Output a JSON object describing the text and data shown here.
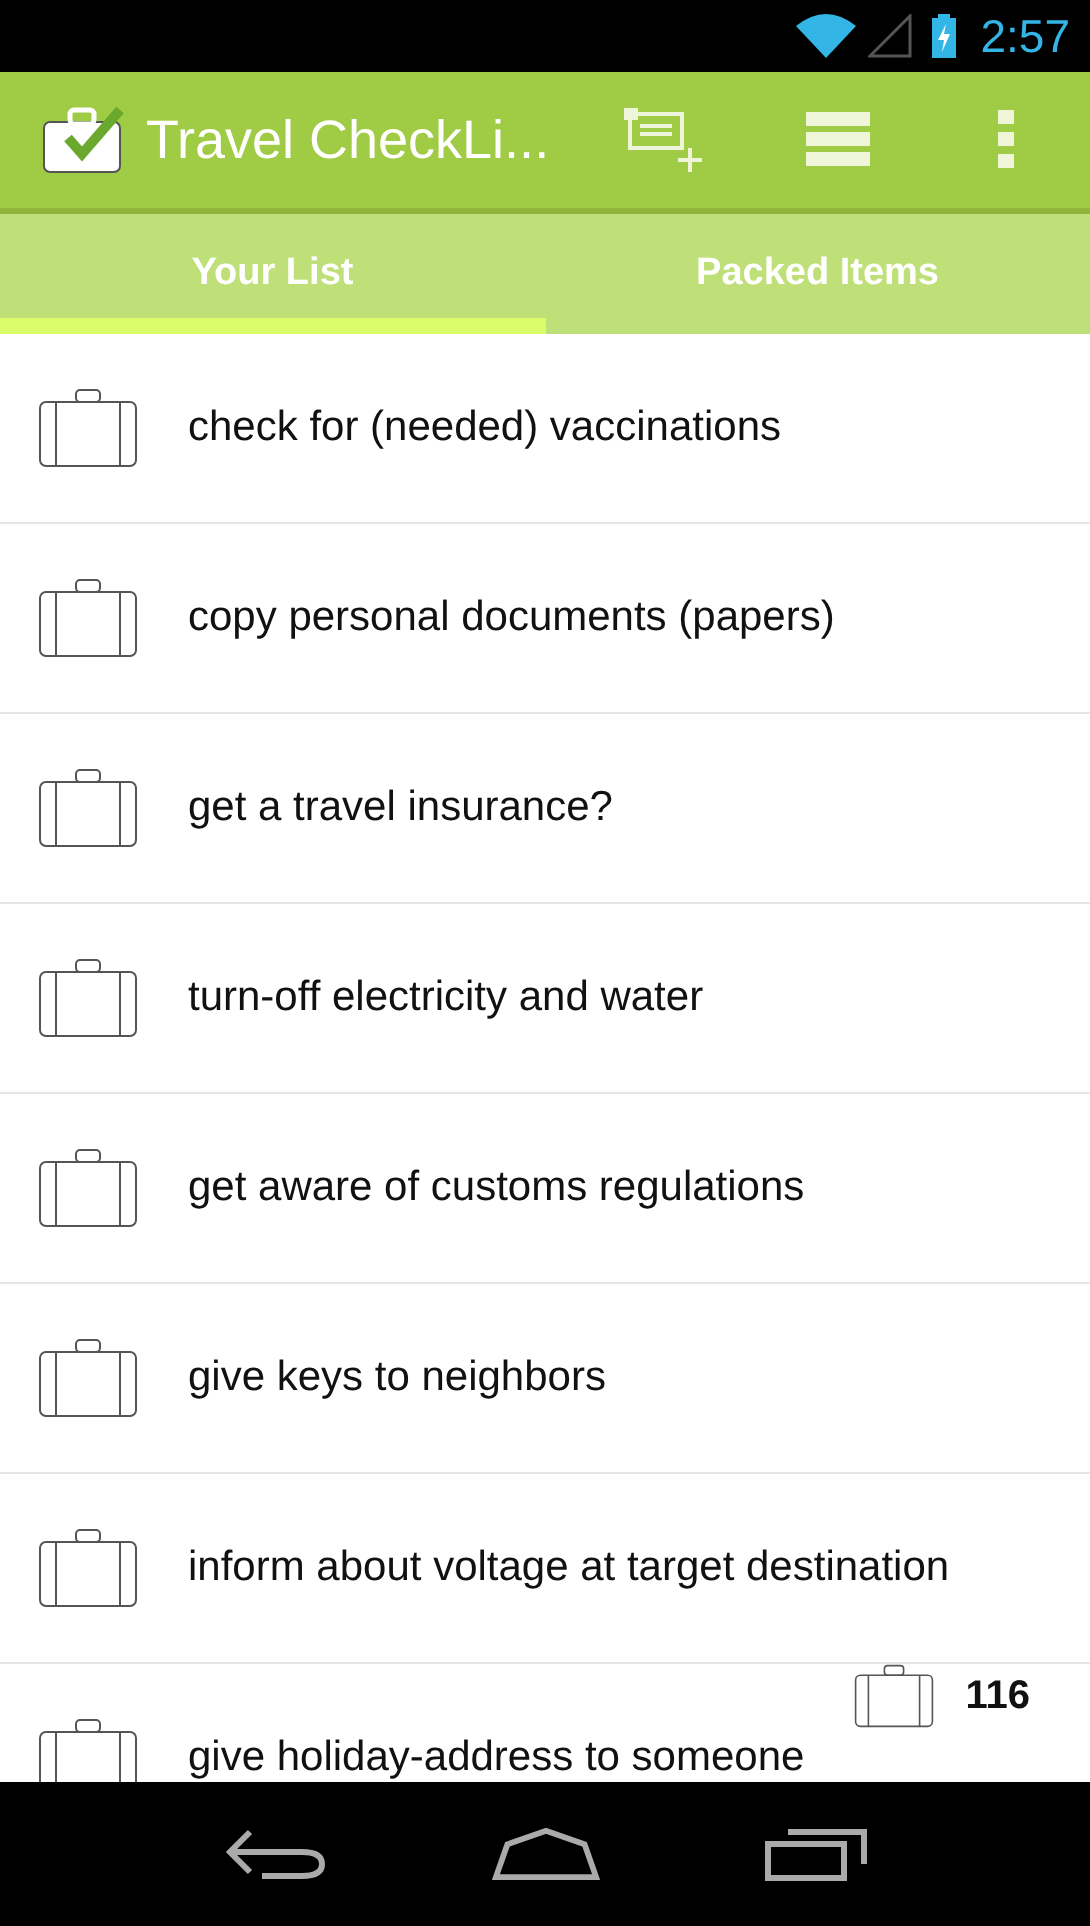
{
  "status_bar": {
    "time": "2:57"
  },
  "app_bar": {
    "title": "Travel CheckLi..."
  },
  "tabs": [
    {
      "label": "Your List",
      "selected": true
    },
    {
      "label": "Packed Items",
      "selected": false
    }
  ],
  "items": [
    {
      "text": "check for (needed) vaccinations"
    },
    {
      "text": "copy personal documents (papers)"
    },
    {
      "text": "get a travel insurance?"
    },
    {
      "text": "turn-off electricity and water"
    },
    {
      "text": "get aware of customs regulations"
    },
    {
      "text": "give keys to neighbors"
    },
    {
      "text": "inform about voltage at target destination"
    },
    {
      "text": "give holiday-address to someone"
    }
  ],
  "counter": {
    "count": "116"
  }
}
